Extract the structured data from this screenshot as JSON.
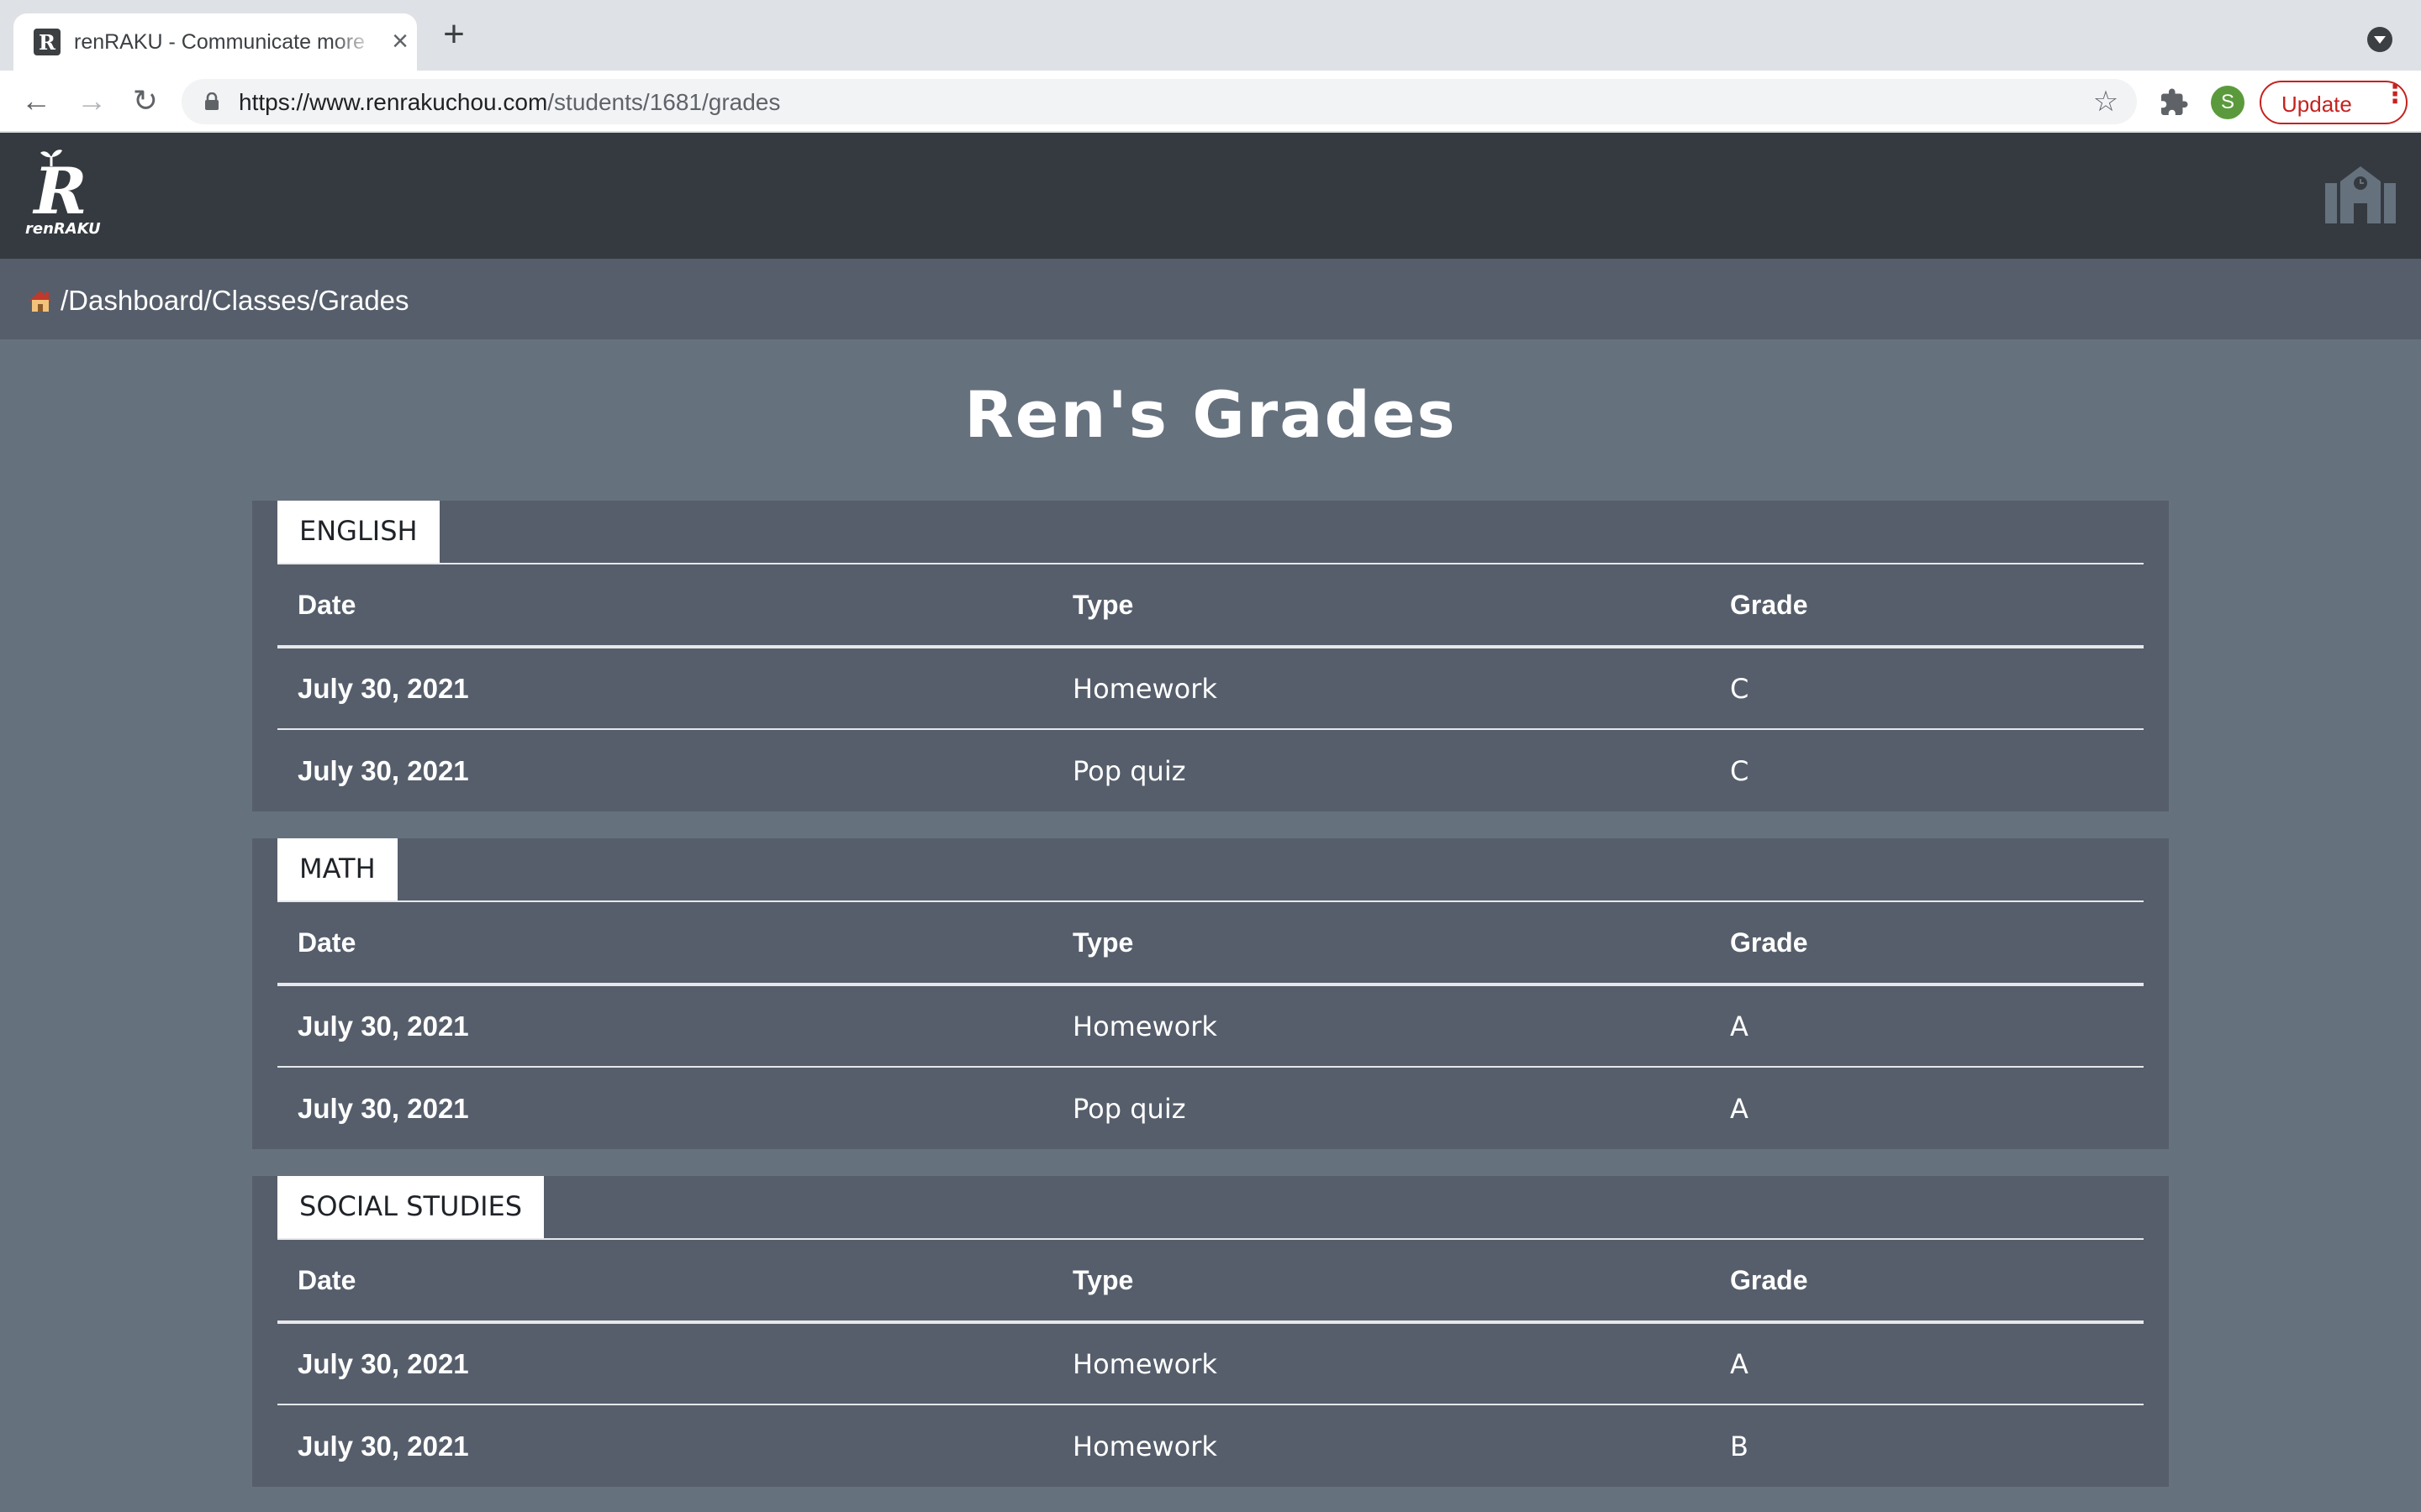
{
  "browser": {
    "tab_title": "renRAKU - Communicate more",
    "tab_favicon_letter": "R",
    "tab_close_glyph": "×",
    "new_tab_glyph": "+",
    "url_host": "https://www.renrakuchou.com",
    "url_path": "/students/1681/grades",
    "profile_initial": "S",
    "update_label": "Update",
    "menu_glyph": "⋮",
    "back_glyph": "←",
    "forward_glyph": "→",
    "reload_glyph": "↻",
    "star_glyph": "☆"
  },
  "header": {
    "logo_letter": "R",
    "logo_text": "renRAKU"
  },
  "breadcrumb": {
    "path": "/Dashboard/Classes/Grades"
  },
  "page": {
    "title": "Ren's Grades"
  },
  "table_headers": {
    "date": "Date",
    "type": "Type",
    "grade": "Grade"
  },
  "subjects": [
    {
      "name": "ENGLISH",
      "rows": [
        {
          "date": "July 30, 2021",
          "type": "Homework",
          "grade": "C"
        },
        {
          "date": "July 30, 2021",
          "type": "Pop quiz",
          "grade": "C"
        }
      ]
    },
    {
      "name": "MATH",
      "rows": [
        {
          "date": "July 30, 2021",
          "type": "Homework",
          "grade": "A"
        },
        {
          "date": "July 30, 2021",
          "type": "Pop quiz",
          "grade": "A"
        }
      ]
    },
    {
      "name": "SOCIAL STUDIES",
      "rows": [
        {
          "date": "July 30, 2021",
          "type": "Homework",
          "grade": "A"
        },
        {
          "date": "July 30, 2021",
          "type": "Homework",
          "grade": "B"
        }
      ]
    }
  ],
  "colors": {
    "page_bg": "#66717e",
    "header_bg": "#343a40",
    "breadcrumb_bg": "#565e6b",
    "card_bg": "#565e6b",
    "accent_update": "#c5221f",
    "avatar_bg": "#5b9a3c"
  },
  "icons": {
    "tab_favicon": "renraku-favicon-icon",
    "lock": "lock-icon",
    "star": "bookmark-star-icon",
    "extensions": "puzzle-piece-icon",
    "school": "school-building-icon",
    "home": "home-icon"
  }
}
